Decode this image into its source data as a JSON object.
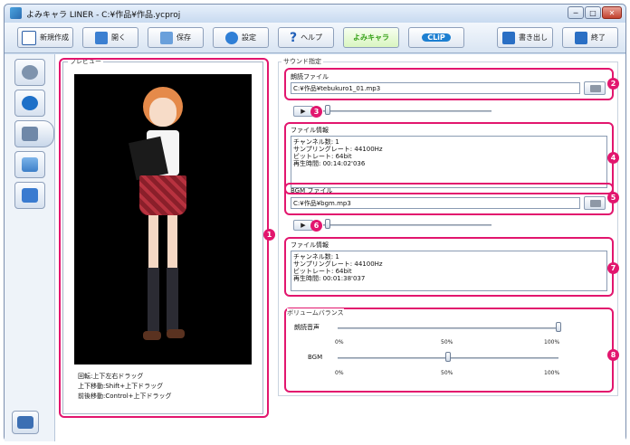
{
  "window": {
    "title": "よみキャラ LINER - C:¥作品¥作品.ycproj",
    "controls": [
      "─",
      "□",
      "✕"
    ]
  },
  "toolbar": {
    "new_label": "新規作成",
    "open_label": "開く",
    "save_label": "保存",
    "settings_label": "設定",
    "help_label": "ヘルプ",
    "brand1_label": "よみキャラ",
    "brand2_label": "CLiP",
    "export_label": "書き出し",
    "exit_label": "終了"
  },
  "sidebar": {
    "items": [
      {
        "icon": "face-icon"
      },
      {
        "icon": "text-icon"
      },
      {
        "icon": "voice-music-icon"
      },
      {
        "icon": "landscape-icon"
      },
      {
        "icon": "movie-icon"
      }
    ],
    "bottom_icon": "audio-wave-icon"
  },
  "preview": {
    "label": "プレビュー",
    "help_lines": [
      "回転:上下左右ドラッグ",
      "上下移動:Shift+上下ドラッグ",
      "前後移動:Control+上下ドラッグ"
    ]
  },
  "sound": {
    "label": "サウンド指定",
    "reading_file_label": "朗読ファイル",
    "reading_file_value": "C:¥作品¥tebukuro1_01.mp3",
    "file_info_label": "ファイル情報",
    "reading_info": "チャンネル数: 1\nサンプリングレート: 44100Hz\nビットレート: 64bit\n再生時間: 00:14:02'036",
    "play_label": "▶",
    "bgm_file_label": "BGM ファイル",
    "bgm_file_value": "C:¥作品¥bgm.mp3",
    "bgm_info": "チャンネル数: 1\nサンプリングレート: 44100Hz\nビットレート: 64bit\n再生時間: 00:01:38'037"
  },
  "volume": {
    "label": "ボリュームバランス",
    "reading_label": "朗読音声",
    "bgm_label": "BGM",
    "ticks": [
      "0%",
      "50%",
      "100%"
    ],
    "reading_level": 1.0,
    "bgm_level": 0.5
  },
  "callouts": [
    "1",
    "2",
    "3",
    "4",
    "5",
    "6",
    "7",
    "8"
  ],
  "colors": {
    "accent": "#e2166e",
    "window_frame": "#cfdff1",
    "preview_bg": "#000000"
  }
}
